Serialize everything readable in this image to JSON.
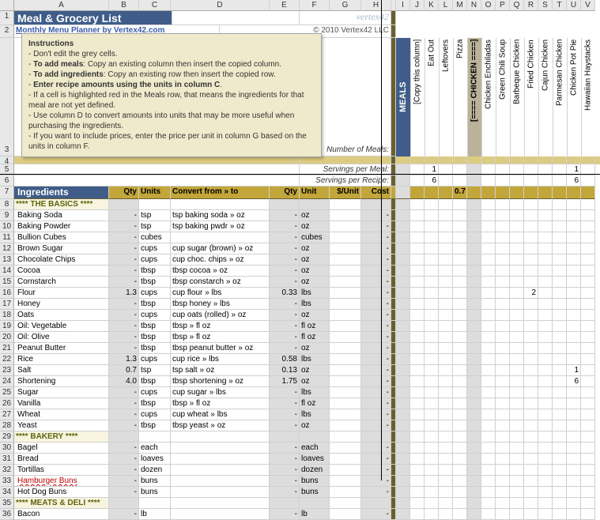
{
  "column_letters": [
    "A",
    "B",
    "C",
    "D",
    "E",
    "F",
    "G",
    "H",
    "I",
    "J",
    "K",
    "L",
    "M",
    "N",
    "O",
    "P",
    "Q",
    "R",
    "S",
    "T",
    "U",
    "V"
  ],
  "title": "Meal & Grocery List",
  "planner_link": "Monthly Menu Planner by Vertex42.com",
  "copyright": "© 2010 Vertex42 LLC",
  "vertex_brand": "vertex42",
  "instructions": {
    "heading": "Instructions",
    "lines": [
      "- Don't edit the grey cells.",
      "- <b>To add meals</b>: Copy an existing column then insert the copied column.",
      "- <b>To add ingredients</b>: Copy an existing row then insert the copied row.",
      "- <b>Enter recipe amounts using the units in column C</b>.",
      "- If a cell is highlighted red in the Meals row, that means the ingredients for that meal are not yet defined.",
      "- Use column D to convert amounts into units that may be more useful when purchasing the ingredients.",
      "- If you want to include prices, enter the price per unit in column G based on the units in column F."
    ]
  },
  "meta": {
    "num_meals": "Number of Meals:",
    "serv_per_meal": "Servings per Meal:",
    "serv_per_recipe": "Servings per Recipe:"
  },
  "meals_label": "MEALS",
  "headers": {
    "ingredients": "Ingredients",
    "qty": "Qty",
    "units": "Units",
    "convert": "Convert from » to",
    "qty2": "Qty",
    "unit": "Unit",
    "price": "$/Unit",
    "cost": "Cost"
  },
  "meals": [
    {
      "label": "[Copy this column]"
    },
    {
      "label": "Eat Out",
      "row5": "1",
      "row6": "6"
    },
    {
      "label": "Leftovers"
    },
    {
      "label": "Pizza",
      "serv": "0.7"
    },
    {
      "label": "[==== CHICKEN ====]",
      "section": true
    },
    {
      "label": "Chicken Enchiladas"
    },
    {
      "label": "Green Chili Soup"
    },
    {
      "label": "Barbeque Chicken"
    },
    {
      "label": "Fried Chicken",
      "flour": "2"
    },
    {
      "label": "Cajun Chicken"
    },
    {
      "label": "Parmesan Chicken"
    },
    {
      "label": "Chicken Pot Pie",
      "row5": "1",
      "row6": "6",
      "salt": "1",
      "short": "6"
    },
    {
      "label": "Hawaiian Haystacks"
    }
  ],
  "ingredients": [
    {
      "row": 8,
      "section": true,
      "name": "**** THE BASICS ****"
    },
    {
      "row": 9,
      "name": "Baking Soda",
      "units": "tsp",
      "convert": "tsp baking soda » oz",
      "unit2": "oz",
      "dash": true
    },
    {
      "row": 10,
      "name": "Baking Powder",
      "units": "tsp",
      "convert": "tsp baking pwdr » oz",
      "unit2": "oz",
      "dash": true
    },
    {
      "row": 11,
      "name": "Bullion Cubes",
      "units": "cubes",
      "unit2": "cubes",
      "dash": true
    },
    {
      "row": 12,
      "name": "Brown Sugar",
      "units": "cups",
      "convert": "cup sugar (brown) » oz",
      "unit2": "oz",
      "dash": true
    },
    {
      "row": 13,
      "name": "Chocolate Chips",
      "units": "cups",
      "convert": "cup choc. chips » oz",
      "unit2": "oz",
      "dash": true
    },
    {
      "row": 14,
      "name": "Cocoa",
      "units": "tbsp",
      "convert": "tbsp cocoa » oz",
      "unit2": "oz",
      "dash": true
    },
    {
      "row": 15,
      "name": "Cornstarch",
      "units": "tbsp",
      "convert": "tbsp constarch » oz",
      "unit2": "oz",
      "dash": true
    },
    {
      "row": 16,
      "name": "Flour",
      "qty": "1.3",
      "units": "cups",
      "convert": "cup flour » lbs",
      "qty2": "0.33",
      "unit2": "lbs"
    },
    {
      "row": 17,
      "name": "Honey",
      "units": "tbsp",
      "convert": "tbsp honey » lbs",
      "unit2": "lbs",
      "dash": true
    },
    {
      "row": 18,
      "name": "Oats",
      "units": "cups",
      "convert": "cup oats (rolled) » oz",
      "unit2": "oz",
      "dash": true
    },
    {
      "row": 19,
      "name": "Oil: Vegetable",
      "units": "tbsp",
      "convert": "tbsp » fl oz",
      "unit2": "fl oz",
      "dash": true
    },
    {
      "row": 20,
      "name": "Oil: Olive",
      "units": "tbsp",
      "convert": "tbsp » fl oz",
      "unit2": "fl oz",
      "dash": true
    },
    {
      "row": 21,
      "name": "Peanut Butter",
      "units": "tbsp",
      "convert": "tbsp peanut butter » oz",
      "unit2": "oz",
      "dash": true
    },
    {
      "row": 22,
      "name": "Rice",
      "qty": "1.3",
      "units": "cups",
      "convert": "cup rice » lbs",
      "qty2": "0.58",
      "unit2": "lbs"
    },
    {
      "row": 23,
      "name": "Salt",
      "qty": "0.7",
      "units": "tsp",
      "convert": "tsp salt » oz",
      "qty2": "0.13",
      "unit2": "oz"
    },
    {
      "row": 24,
      "name": "Shortening",
      "qty": "4.0",
      "units": "tbsp",
      "convert": "tbsp shortening » oz",
      "qty2": "1.75",
      "unit2": "oz"
    },
    {
      "row": 25,
      "name": "Sugar",
      "units": "cups",
      "convert": "cup sugar » lbs",
      "unit2": "lbs",
      "dash": true
    },
    {
      "row": 26,
      "name": "Vanilla",
      "units": "tbsp",
      "convert": "tbsp » fl oz",
      "unit2": "fl oz",
      "dash": true
    },
    {
      "row": 27,
      "name": "Wheat",
      "units": "cups",
      "convert": "cup wheat » lbs",
      "unit2": "lbs",
      "dash": true
    },
    {
      "row": 28,
      "name": "Yeast",
      "units": "tbsp",
      "convert": "tbsp yeast » oz",
      "unit2": "oz",
      "dash": true
    },
    {
      "row": 29,
      "section": true,
      "name": "**** BAKERY ****"
    },
    {
      "row": 30,
      "name": "Bagel",
      "units": "each",
      "unit2": "each",
      "dash": true
    },
    {
      "row": 31,
      "name": "Bread",
      "units": "loaves",
      "unit2": "loaves",
      "dash": true
    },
    {
      "row": 32,
      "name": "Tortillas",
      "units": "dozen",
      "unit2": "dozen",
      "dash": true
    },
    {
      "row": 33,
      "name": "Hamburger Buns",
      "units": "buns",
      "unit2": "buns",
      "dash": true,
      "err": true
    },
    {
      "row": 34,
      "name": "Hot Dog Buns",
      "units": "buns",
      "unit2": "buns",
      "dash": true
    },
    {
      "row": 35,
      "section": true,
      "name": "**** MEATS & DELI ****"
    },
    {
      "row": 36,
      "name": "Bacon",
      "units": "lb",
      "unit2": "lb",
      "dash": true
    }
  ]
}
